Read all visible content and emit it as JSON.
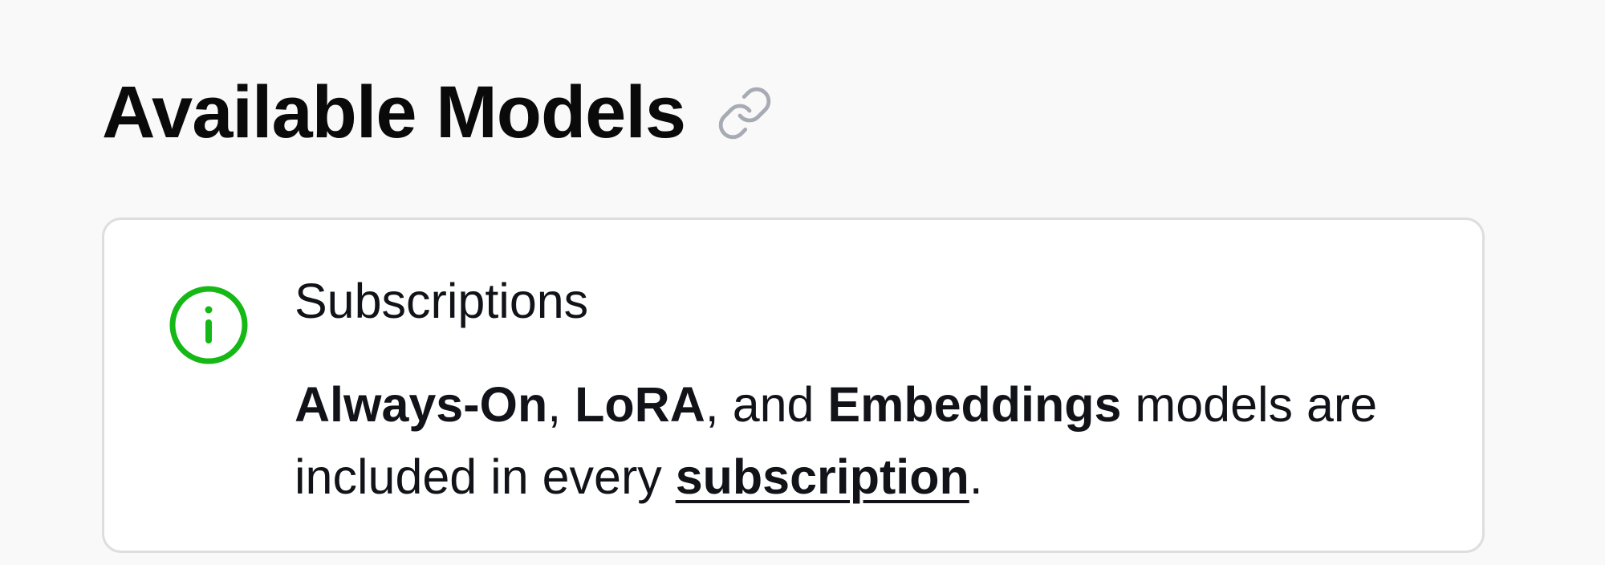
{
  "heading": {
    "title": "Available Models",
    "anchor_icon": "link-icon"
  },
  "callout": {
    "icon": "info-icon",
    "title": "Subscriptions",
    "body": {
      "always_on": "Always-On",
      "sep1": ", ",
      "lora": "LoRA",
      "sep2": ", and ",
      "embeddings": "Embeddings",
      "text_mid": " models are included in every ",
      "link": "subscription",
      "text_end": "."
    }
  },
  "colors": {
    "background": "#f9f9f9",
    "card": "#ffffff",
    "card_border": "#dedede",
    "info_accent": "#16b816",
    "link_icon": "#a7abb4",
    "text": "#111318"
  }
}
